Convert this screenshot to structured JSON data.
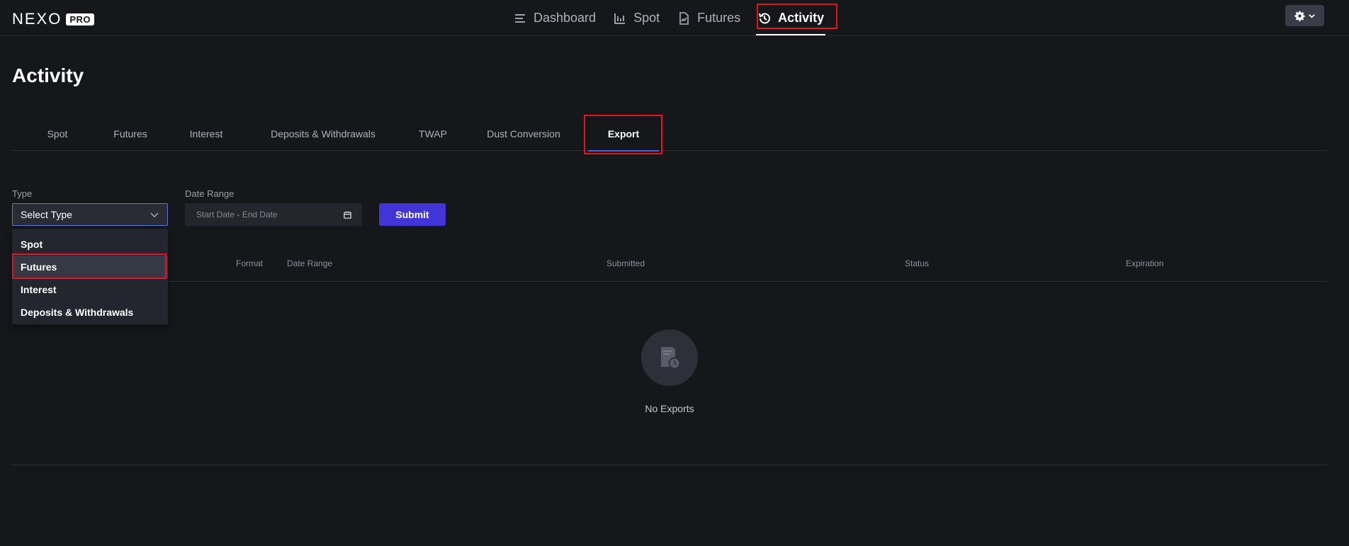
{
  "brand": {
    "word": "NEXO",
    "badge": "PRO"
  },
  "nav": {
    "items": [
      {
        "label": "Dashboard",
        "icon": "menu-lines-icon",
        "active": false
      },
      {
        "label": "Spot",
        "icon": "chart-icon",
        "active": false
      },
      {
        "label": "Futures",
        "icon": "document-chart-icon",
        "active": false
      },
      {
        "label": "Activity",
        "icon": "history-icon",
        "active": true
      }
    ],
    "settings_icon": "gear-icon"
  },
  "page": {
    "title": "Activity"
  },
  "tabs": [
    {
      "label": "Spot"
    },
    {
      "label": "Futures"
    },
    {
      "label": "Interest"
    },
    {
      "label": "Deposits & Withdrawals"
    },
    {
      "label": "TWAP"
    },
    {
      "label": "Dust Conversion"
    },
    {
      "label": "Export",
      "active": true
    }
  ],
  "filters": {
    "type_label": "Type",
    "type_value": "Select Type",
    "date_label": "Date Range",
    "date_placeholder": "Start Date - End Date",
    "submit_label": "Submit"
  },
  "dropdown": {
    "options": [
      "Spot",
      "Futures",
      "Interest",
      "Deposits & Withdrawals"
    ],
    "hovered": "Futures"
  },
  "table": {
    "columns": [
      "Format",
      "Date Range",
      "Submitted",
      "Status",
      "Expiration"
    ],
    "empty_text": "No Exports"
  },
  "colors": {
    "background": "#16171b",
    "accent": "#4135d8",
    "tab_underline": "#4f5be3",
    "highlight": "#e5141f"
  }
}
